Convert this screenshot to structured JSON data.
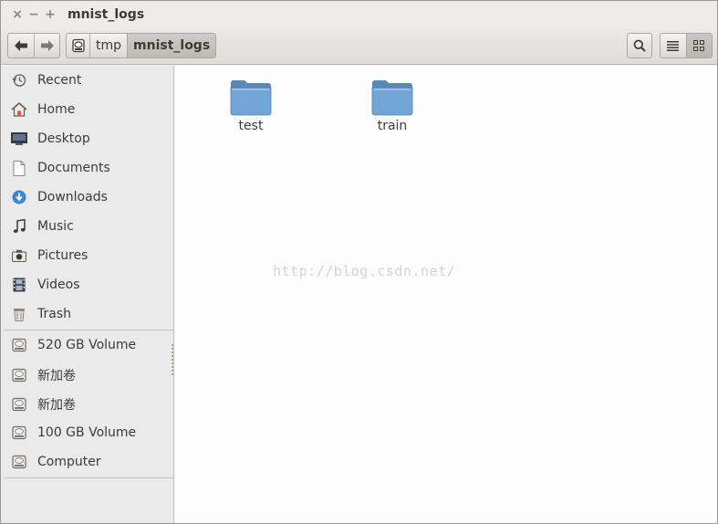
{
  "window": {
    "title": "mnist_logs"
  },
  "titlebar": {
    "close": "×",
    "minimize": "−",
    "maximize": "+"
  },
  "pathbar": {
    "segments": [
      "tmp",
      "mnist_logs"
    ]
  },
  "sidebar": {
    "places": [
      {
        "label": "Recent",
        "icon": "clock-icon"
      },
      {
        "label": "Home",
        "icon": "home-icon"
      },
      {
        "label": "Desktop",
        "icon": "desktop-icon"
      },
      {
        "label": "Documents",
        "icon": "document-icon"
      },
      {
        "label": "Downloads",
        "icon": "download-icon"
      },
      {
        "label": "Music",
        "icon": "music-icon"
      },
      {
        "label": "Pictures",
        "icon": "camera-icon"
      },
      {
        "label": "Videos",
        "icon": "film-icon"
      },
      {
        "label": "Trash",
        "icon": "trash-icon"
      }
    ],
    "devices": [
      {
        "label": "520 GB Volume",
        "icon": "drive-icon"
      },
      {
        "label": "新加卷",
        "icon": "drive-icon"
      },
      {
        "label": "新加卷",
        "icon": "drive-icon"
      },
      {
        "label": "100 GB Volume",
        "icon": "drive-icon"
      },
      {
        "label": "Computer",
        "icon": "drive-icon"
      }
    ]
  },
  "content": {
    "files": [
      {
        "name": "test",
        "icon": "folder-icon"
      },
      {
        "name": "train",
        "icon": "folder-icon"
      }
    ],
    "watermark": "http://blog.csdn.net/"
  },
  "colors": {
    "folder": "#6b9fd0",
    "background": "#fdfdfd",
    "sidebar": "#eaeaea"
  }
}
